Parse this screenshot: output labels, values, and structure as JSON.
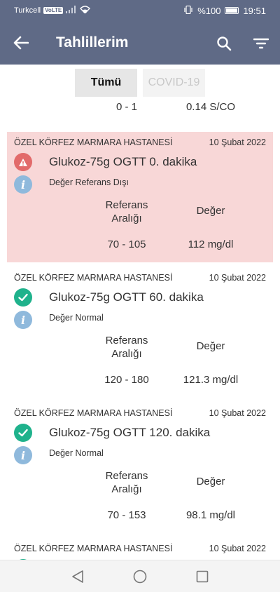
{
  "status_bar": {
    "carrier": "Turkcell",
    "network_badge": "VoLTE",
    "battery_percent": "%100",
    "time": "19:51",
    "icons": [
      "signal-icon",
      "wifi-icon",
      "vibrate-icon",
      "battery-icon"
    ]
  },
  "app_bar": {
    "title": "Tahlillerim",
    "icons": [
      "back-arrow-icon",
      "search-icon",
      "filter-icon"
    ]
  },
  "tabs": [
    {
      "label": "Tümü",
      "selected": true
    },
    {
      "label": "COVID-19",
      "selected": false
    }
  ],
  "previous_row": {
    "ref_range": "0 - 1",
    "value": "0.14 S/CO"
  },
  "columns": {
    "ref_range": "Referans Aralığı",
    "value": "Değer"
  },
  "results": [
    {
      "hospital": "ÖZEL KÖRFEZ MARMARA HASTANESİ",
      "date": "10 Şubat 2022",
      "test_name": "Glukoz-75g OGTT 0. dakika",
      "status_text": "Değer Referans Dışı",
      "status": "warning",
      "ref_range": "70 - 105",
      "value": "112 mg/dl"
    },
    {
      "hospital": "ÖZEL KÖRFEZ MARMARA HASTANESİ",
      "date": "10 Şubat 2022",
      "test_name": "Glukoz-75g OGTT 60. dakika",
      "status_text": "Değer Normal",
      "status": "normal",
      "ref_range": "120 - 180",
      "value": "121.3 mg/dl"
    },
    {
      "hospital": "ÖZEL KÖRFEZ MARMARA HASTANESİ",
      "date": "10 Şubat 2022",
      "test_name": "Glukoz-75g OGTT 120. dakika",
      "status_text": "Değer Normal",
      "status": "normal",
      "ref_range": "70 - 153",
      "value": "98.1 mg/dl"
    },
    {
      "hospital": "ÖZEL KÖRFEZ MARMARA HASTANESİ",
      "date": "10 Şubat 2022",
      "status": "normal"
    }
  ],
  "colors": {
    "app_bar": "#5f6a86",
    "alert_background": "#f8d7d7",
    "warning_icon": "#e26a6a",
    "normal_icon": "#1fb28c",
    "info_icon": "#8fb9dc"
  },
  "nav_bar": {
    "icons": [
      "nav-back-icon",
      "nav-home-icon",
      "nav-recents-icon"
    ]
  }
}
